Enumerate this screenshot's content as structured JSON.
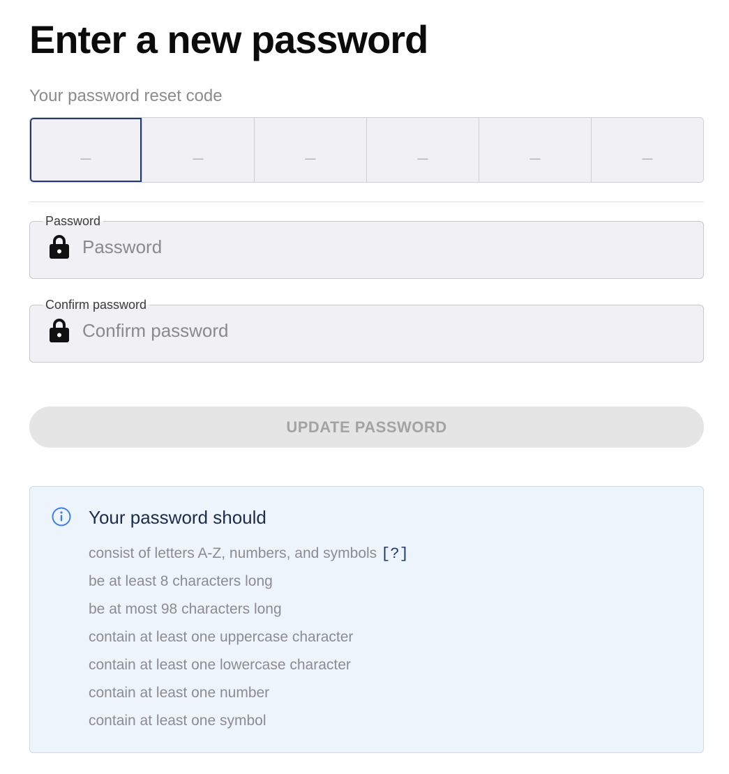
{
  "title": "Enter a new password",
  "reset_code": {
    "label": "Your password reset code",
    "cells": [
      "_",
      "_",
      "_",
      "_",
      "_",
      "_"
    ]
  },
  "password_field": {
    "legend": "Password",
    "placeholder": "Password",
    "icon": "lock-icon"
  },
  "confirm_field": {
    "legend": "Confirm password",
    "placeholder": "Confirm password",
    "icon": "lock-icon"
  },
  "update_button": {
    "label": "UPDATE PASSWORD",
    "enabled": false
  },
  "requirements": {
    "icon": "info-icon",
    "title": "Your password should",
    "help_link": "[?]",
    "items": [
      "consist of letters A-Z, numbers, and symbols",
      "be at least 8 characters long",
      "be at most 98 characters long",
      "contain at least one uppercase character",
      "contain at least one lowercase character",
      "contain at least one number",
      "contain at least one symbol"
    ]
  },
  "colors": {
    "accent": "#22376b",
    "field_bg": "#f1f1f5",
    "info_bg": "#eef4fc",
    "button_disabled_bg": "#e5e5e5"
  }
}
